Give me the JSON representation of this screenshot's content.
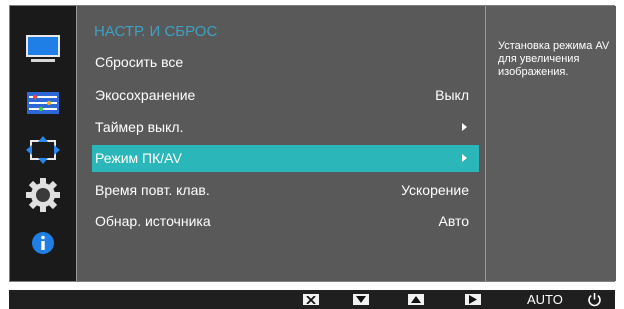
{
  "menu": {
    "title": "НАСТР. И СБРОС",
    "items": [
      {
        "label": "Сбросить все",
        "value": "",
        "arrow": false
      },
      {
        "label": "Экосохранение",
        "value": "Выкл",
        "arrow": false
      },
      {
        "label": "Таймер выкл.",
        "value": "",
        "arrow": true
      },
      {
        "label": "Режим ПК/AV",
        "value": "",
        "arrow": true,
        "selected": true
      },
      {
        "label": "Время повт. клав.",
        "value": "Ускорение",
        "arrow": false
      },
      {
        "label": "Обнар. источника",
        "value": "Авто",
        "arrow": false
      }
    ]
  },
  "sidebar": {
    "icons": [
      "monitor-icon",
      "color-settings-icon",
      "resize-icon",
      "gear-icon",
      "info-icon"
    ]
  },
  "help": {
    "text": "Установка режима AV для увеличения изображения."
  },
  "bottom_bar": {
    "keys": [
      "close-key-icon",
      "down-key-icon",
      "up-key-icon",
      "right-key-icon"
    ],
    "auto_label": "AUTO",
    "power_icon": "power-icon"
  },
  "colors": {
    "title_accent": "#3ea1c4",
    "selected_row": "#2bb7b9",
    "panel_bg": "#595959",
    "sidebar_bg": "#1a1a1a"
  }
}
